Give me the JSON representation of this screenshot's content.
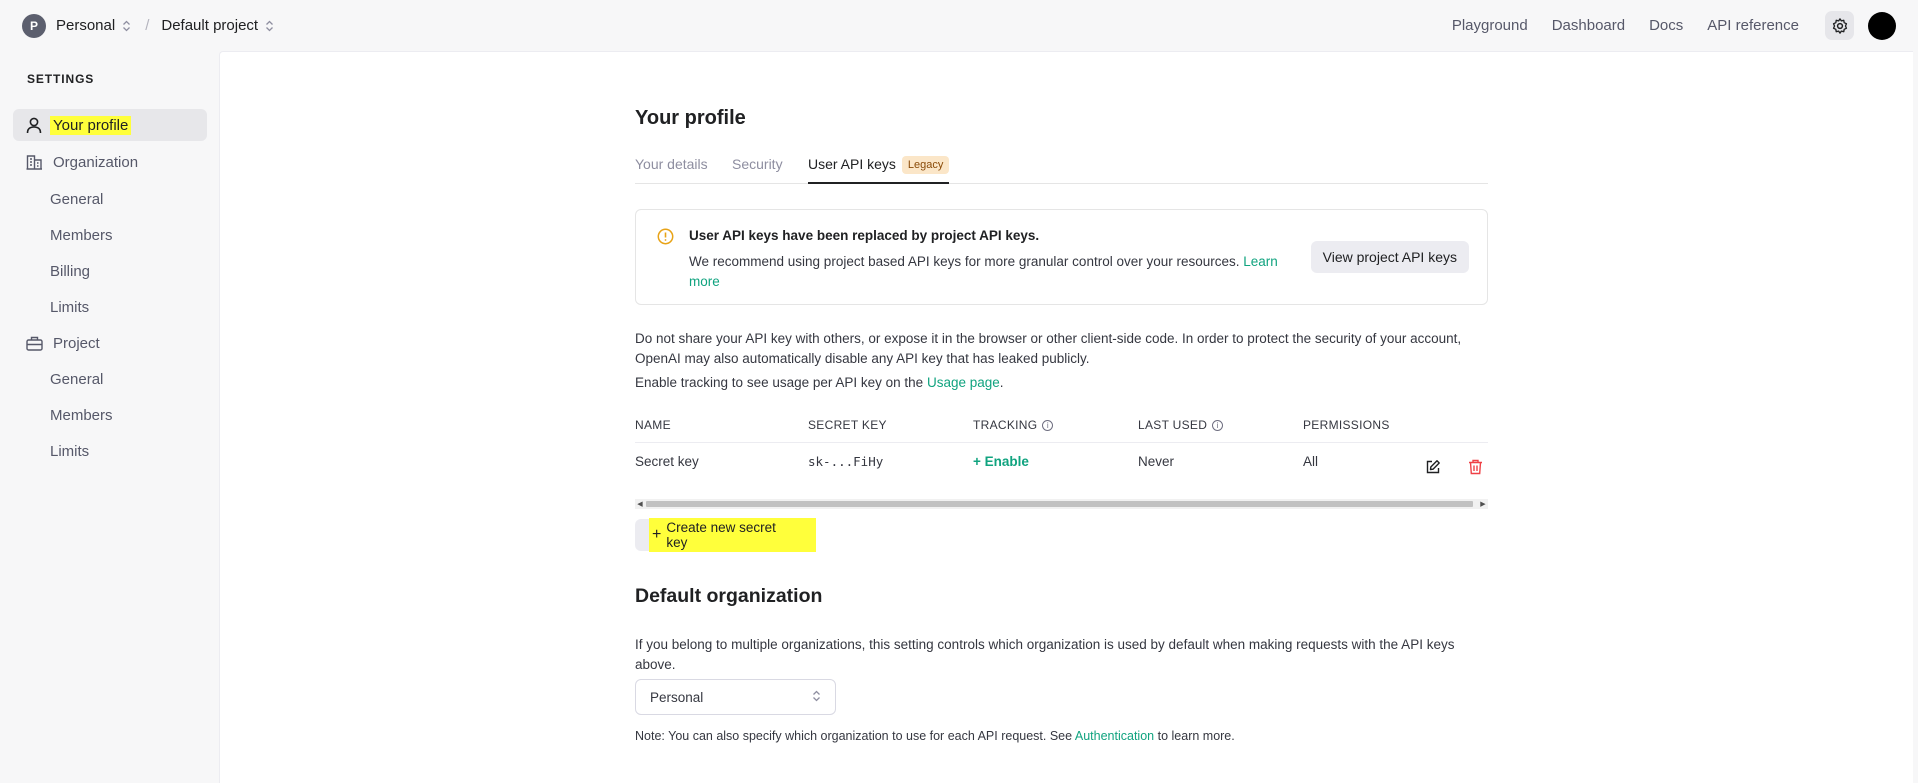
{
  "topbar": {
    "org_initial": "P",
    "org_name": "Personal",
    "separator": "/",
    "project_name": "Default project",
    "links": [
      "Playground",
      "Dashboard",
      "Docs",
      "API reference"
    ]
  },
  "sidebar": {
    "heading": "SETTINGS",
    "your_profile": "Your profile",
    "organization": {
      "label": "Organization",
      "items": [
        "General",
        "Members",
        "Billing",
        "Limits"
      ]
    },
    "project": {
      "label": "Project",
      "items": [
        "General",
        "Members",
        "Limits"
      ]
    }
  },
  "main": {
    "title": "Your profile",
    "tabs": [
      "Your details",
      "Security",
      "User API keys"
    ],
    "legacy_badge": "Legacy",
    "notice": {
      "title": "User API keys have been replaced by project API keys.",
      "body": "We recommend using project based API keys for more granular control over your resources.",
      "link": "Learn more",
      "button": "View project API keys"
    },
    "warning_text": "Do not share your API key with others, or expose it in the browser or other client-side code. In order to protect the security of your account, OpenAI may also automatically disable any API key that has leaked publicly.",
    "tracking_text": "Enable tracking to see usage per API key on the",
    "usage_link": "Usage page",
    "table": {
      "headers": [
        "NAME",
        "SECRET KEY",
        "TRACKING",
        "LAST USED",
        "PERMISSIONS"
      ],
      "rows": [
        {
          "name": "Secret key",
          "secret": "sk-...FiHy",
          "tracking": "+ Enable",
          "last_used": "Never",
          "permissions": "All"
        }
      ]
    },
    "create_button": "Create new secret key",
    "default_org": {
      "title": "Default organization",
      "description": "If you belong to multiple organizations, this setting controls which organization is used by default when making requests with the API keys above.",
      "selected": "Personal",
      "note_prefix": "Note: You can also specify which organization to use for each API request. See",
      "note_link": "Authentication",
      "note_suffix": "to learn more."
    }
  },
  "colors": {
    "accent_green": "#10a37f",
    "highlight_yellow": "#ffff3b",
    "delete_red": "#ef4146"
  }
}
